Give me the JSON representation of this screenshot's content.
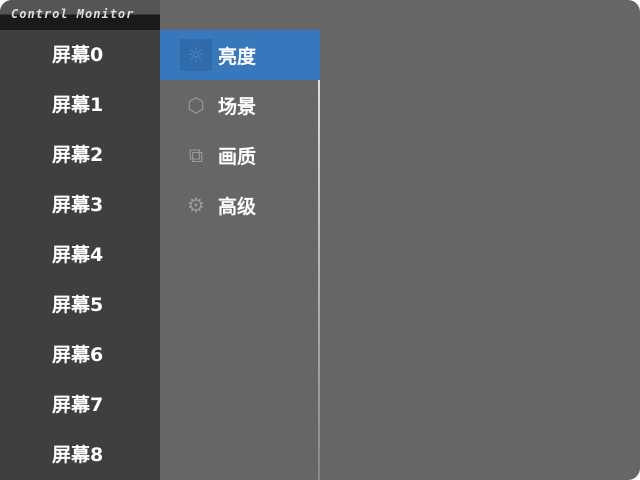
{
  "title": "Control Monitor",
  "screens": [
    "屏幕0",
    "屏幕1",
    "屏幕2",
    "屏幕3",
    "屏幕4",
    "屏幕5",
    "屏幕6",
    "屏幕7",
    "屏幕8"
  ],
  "selected_screen": "屏幕0",
  "options": [
    {
      "label": "亮度",
      "icon": "brightness-icon"
    },
    {
      "label": "场景",
      "icon": "scene-icon"
    },
    {
      "label": "画质",
      "icon": "image-quality-icon"
    },
    {
      "label": "高级",
      "icon": "advanced-gear-icon"
    }
  ],
  "selected_option": "亮度",
  "colors": {
    "accent": "#3778bd",
    "sidebar": "#3f3f3f",
    "background": "#666666"
  }
}
